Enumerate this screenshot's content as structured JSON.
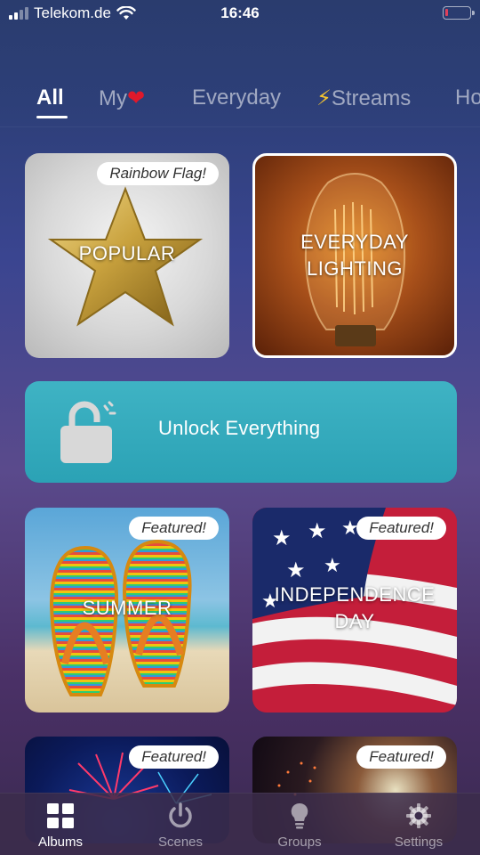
{
  "status_bar": {
    "carrier": "Telekom.de",
    "time": "16:46"
  },
  "tabs": {
    "all": "All",
    "my": "My",
    "everyday": "Everyday",
    "streams": "Streams",
    "holidays": "Ho"
  },
  "cards": {
    "popular": {
      "title": "POPULAR",
      "badge": "Rainbow Flag!"
    },
    "everyday": {
      "title_line1": "EVERYDAY",
      "title_line2": "LIGHTING"
    },
    "summer": {
      "title": "SUMMER",
      "badge": "Featured!"
    },
    "independence": {
      "title_line1": "INDEPENDENCE",
      "title_line2": "DAY",
      "badge": "Featured!"
    },
    "fireworks1": {
      "badge": "Featured!"
    },
    "fireworks2": {
      "badge": "Featured!"
    }
  },
  "unlock": {
    "label": "Unlock Everything"
  },
  "tabbar": {
    "albums": "Albums",
    "scenes": "Scenes",
    "groups": "Groups",
    "settings": "Settings"
  },
  "colors": {
    "unlock_bg": "#2ba2b5",
    "heart": "#e0192b",
    "bolt": "#f4c430",
    "battery_low": "#e0405a"
  },
  "icons": [
    "signal-icon",
    "wifi-icon",
    "battery-icon",
    "heart-icon",
    "bolt-icon",
    "lock-icon",
    "albums-icon",
    "power-icon",
    "bulb-icon",
    "gear-icon"
  ]
}
